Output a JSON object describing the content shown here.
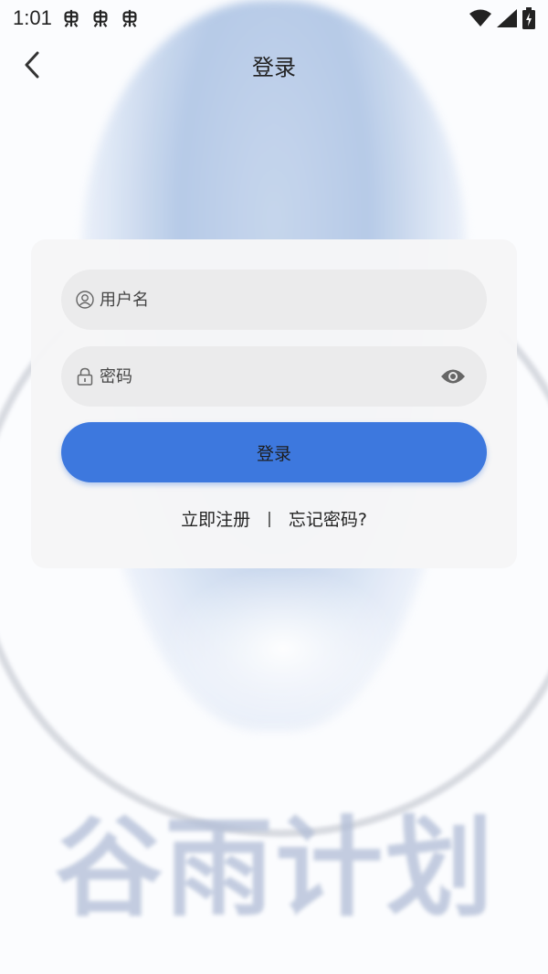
{
  "status_bar": {
    "time": "1:01"
  },
  "nav": {
    "title": "登录"
  },
  "login_form": {
    "username_placeholder": "用户名",
    "password_placeholder": "密码",
    "submit_label": "登录",
    "register_link": "立即注册",
    "separator": "|",
    "forgot_link": "忘记密码?"
  },
  "background": {
    "logo_text": [
      "谷",
      "雨",
      "计",
      "划"
    ]
  },
  "colors": {
    "primary_button": "#3d78de",
    "card_bg": "#f6f6f7",
    "field_bg": "#ebebec"
  },
  "icons": {
    "back": "chevron-left-icon",
    "user": "user-icon",
    "lock": "lock-icon",
    "eye": "eye-icon",
    "wifi": "wifi-icon",
    "signal": "signal-icon",
    "battery": "battery-icon",
    "notification": "bug-icon"
  }
}
